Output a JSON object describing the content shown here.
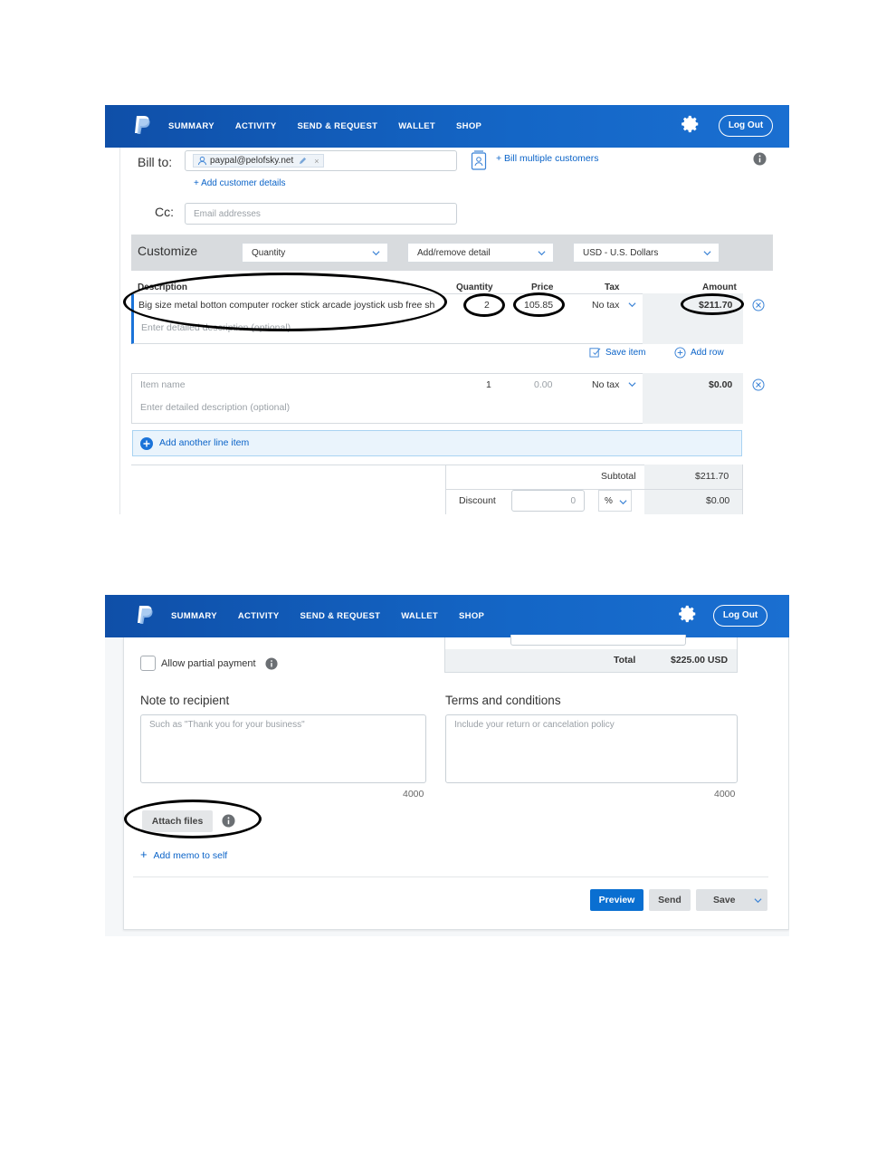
{
  "nav": {
    "items": [
      "SUMMARY",
      "ACTIVITY",
      "SEND & REQUEST",
      "WALLET",
      "SHOP"
    ],
    "logout_label": "Log Out"
  },
  "invoice": {
    "bill_to_label": "Bill to:",
    "bill_to_email": "paypal@pelofsky.net",
    "bill_multiple": "+ Bill multiple customers",
    "add_customer_details": "+ Add customer details",
    "cc_label": "Cc:",
    "cc_placeholder": "Email addresses",
    "customize_label": "Customize",
    "customize_quantity": "Quantity",
    "customize_detail": "Add/remove detail",
    "customize_currency": "USD - U.S. Dollars",
    "col_description": "Description",
    "col_quantity": "Quantity",
    "col_price": "Price",
    "col_tax": "Tax",
    "col_amount": "Amount",
    "item1": {
      "name": "Big size metal botton computer rocker stick arcade joystick usb free sh",
      "detail_placeholder": "Enter detailed description (optional)",
      "quantity": "2",
      "price": "105.85",
      "tax": "No tax",
      "amount": "$211.70"
    },
    "save_item": "Save item",
    "add_row": "Add row",
    "item2": {
      "name_placeholder": "Item name",
      "detail_placeholder": "Enter detailed description (optional)",
      "quantity": "1",
      "price": "0.00",
      "tax": "No tax",
      "amount": "$0.00"
    },
    "add_another": "Add another line item",
    "subtotal_label": "Subtotal",
    "subtotal_value": "$211.70",
    "discount_label": "Discount",
    "discount_input": "0",
    "discount_unit": "%",
    "discount_value": "$0.00"
  },
  "footer": {
    "total_label": "Total",
    "total_value": "$225.00 USD",
    "allow_partial": "Allow partial payment",
    "note_label": "Note to recipient",
    "note_placeholder": "Such as \"Thank you for your business\"",
    "note_count": "4000",
    "terms_label": "Terms and conditions",
    "terms_placeholder": "Include your return or cancelation policy",
    "terms_count": "4000",
    "attach_files": "Attach files",
    "add_memo": "Add memo to self",
    "preview": "Preview",
    "send": "Send",
    "save": "Save"
  },
  "colors": {
    "nav_blue": "#1466c6",
    "link_blue": "#0a63c8",
    "preview_blue": "#0a6fd1"
  }
}
